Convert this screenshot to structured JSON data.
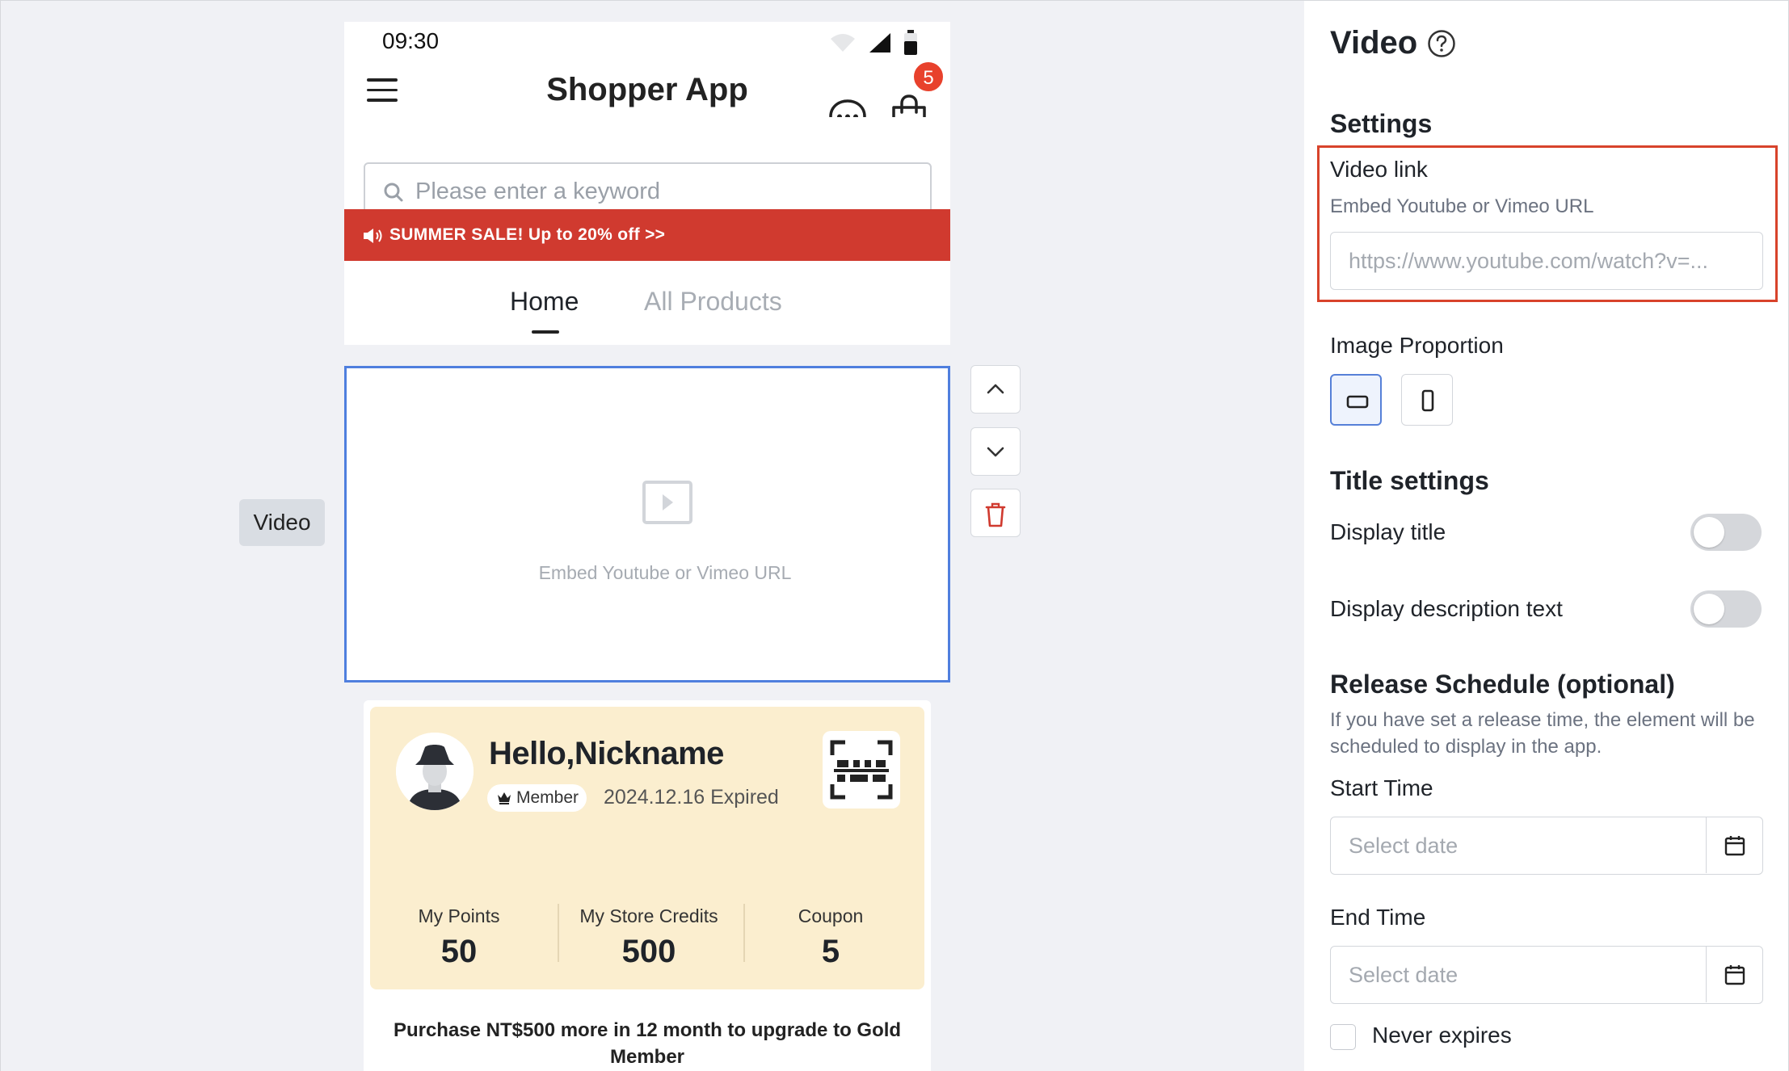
{
  "phone": {
    "status_time": "09:30",
    "app_title": "Shopper App",
    "cart_badge": "5",
    "search_placeholder": "Please enter a keyword",
    "promo_text": "SUMMER SALE! Up to 20% off >>",
    "tabs": [
      {
        "label": "Home",
        "active": true
      },
      {
        "label": "All Products",
        "active": false
      }
    ],
    "video_hint": "Embed Youtube or Vimeo URL",
    "element_label": "Video",
    "member": {
      "greeting": "Hello,Nickname",
      "tier": "Member",
      "expiry": "2024.12.16 Expired",
      "stats": [
        {
          "label": "My Points",
          "value": "50"
        },
        {
          "label": "My Store Credits",
          "value": "500"
        },
        {
          "label": "Coupon",
          "value": "5"
        }
      ],
      "upgrade_text": "Purchase NT$500 more in 12 month to upgrade to Gold Member"
    }
  },
  "panel": {
    "title": "Video",
    "settings_heading": "Settings",
    "video_link_label": "Video link",
    "video_link_help": "Embed Youtube or Vimeo URL",
    "video_link_placeholder": "https://www.youtube.com/watch?v=...",
    "image_proportion_label": "Image Proportion",
    "proportion_options": [
      "landscape",
      "portrait"
    ],
    "proportion_selected": "landscape",
    "title_settings_heading": "Title settings",
    "display_title_label": "Display title",
    "display_title_on": false,
    "display_description_label": "Display description text",
    "display_description_on": false,
    "release_heading": "Release Schedule (optional)",
    "release_help": "If you have set a release time, the element will be scheduled to display in the app.",
    "start_time_label": "Start Time",
    "start_time_placeholder": "Select date",
    "end_time_label": "End Time",
    "end_time_placeholder": "Select date",
    "never_expires_label": "Never expires",
    "never_expires_checked": false
  },
  "colors": {
    "accent_blue": "#4f7fde",
    "promo_red": "#d03a2f",
    "highlight_red": "#d8432b",
    "member_card": "#fbeecf",
    "badge_red": "#e8412c"
  }
}
